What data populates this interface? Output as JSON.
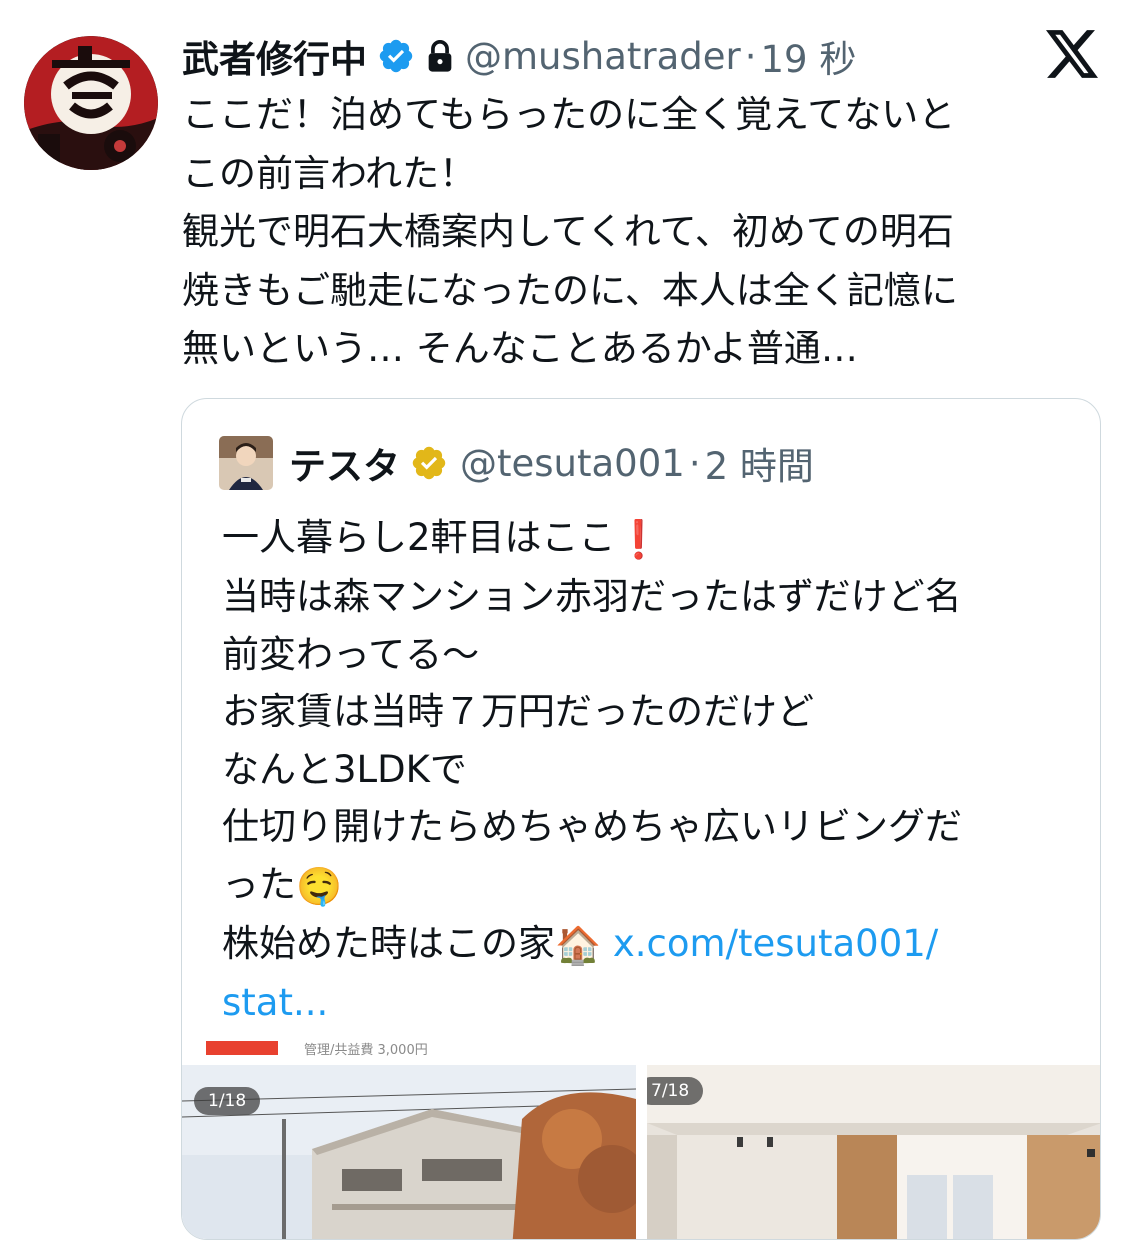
{
  "tweet": {
    "display_name": "武者修行中",
    "handle": "@mushatrader",
    "separator": "·",
    "time": "19 秒",
    "text_lines": [
      "ここだ！泊めてもらったのに全く覚えてないと",
      "この前言われた！",
      "観光で明石大橋案内してくれて、初めての明石",
      "焼きもご馳走になったのに、本人は全く記憶に",
      "無いという… そんなことあるかよ普通…"
    ],
    "icons": {
      "verified": "verified-badge-icon",
      "lock": "lock-icon",
      "brand": "x-logo-icon"
    }
  },
  "quote": {
    "display_name": "テスタ",
    "handle": "@tesuta001",
    "separator": "·",
    "time": "2 時間",
    "lines": [
      {
        "text": "一人暮らし2軒目はここ",
        "emoji": "❗"
      },
      {
        "text": "当時は森マンション赤羽だったはずだけど名"
      },
      {
        "text": "前変わってる〜"
      },
      {
        "text": "お家賃は当時７万円だったのだけど"
      },
      {
        "text": "なんと3LDKで"
      },
      {
        "text": "仕切り開けたらめちゃめちゃ広いリビングだ"
      },
      {
        "text": "った",
        "emoji": "🤤"
      },
      {
        "text": "株始めた時はこの家",
        "emoji": "🏠",
        "link": "x.com/tesuta001/"
      },
      {
        "link": "stat..."
      }
    ],
    "media": [
      {
        "counter": "1/18",
        "price_snippet": "管理/共益費 3,000円"
      },
      {
        "counter": "7/18"
      }
    ]
  },
  "colors": {
    "text": "#0f1419",
    "secondary": "#536471",
    "link": "#1d9bf0",
    "verified_blue": "#1d9bf0",
    "verified_gold": "#e2b719",
    "border": "#cfd9de"
  }
}
